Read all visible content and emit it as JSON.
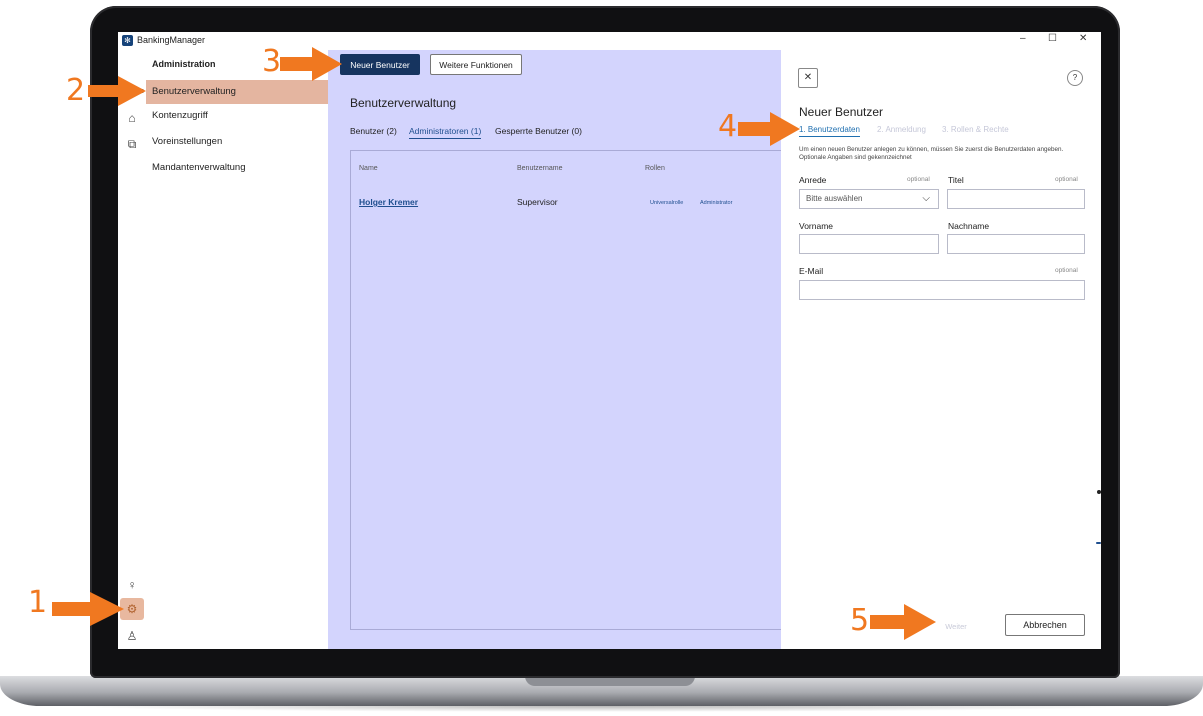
{
  "window": {
    "title": "BankingManager",
    "logo_glyph": "✻",
    "minimize": "–",
    "maximize": "☐",
    "close": "✕"
  },
  "rail": {
    "icons": [
      "bank-icon",
      "payments-icon",
      "support-icon",
      "settings-icon",
      "user-icon"
    ],
    "glyphs": {
      "bank": "⌂",
      "payments": "⧉",
      "support": "♀",
      "settings": "⚙",
      "user": "♙"
    }
  },
  "nav": {
    "header": "Administration",
    "items": [
      {
        "label": "Benutzerverwaltung",
        "active": true
      },
      {
        "label": "Kontenzugriff",
        "active": false
      },
      {
        "label": "Voreinstellungen",
        "active": false
      },
      {
        "label": "Mandantenverwaltung",
        "active": false
      }
    ]
  },
  "toolbar": {
    "new_user": "Neuer Benutzer",
    "more_functions": "Weitere Funktionen"
  },
  "main": {
    "title": "Benutzerverwaltung",
    "tabs": [
      {
        "label": "Benutzer (2)",
        "active": false
      },
      {
        "label": "Administratoren (1)",
        "active": true
      },
      {
        "label": "Gesperrte Benutzer (0)",
        "active": false
      }
    ],
    "table": {
      "headers": [
        "Name",
        "Benutzername",
        "Rollen"
      ],
      "rows": [
        {
          "name": "Holger Kremer",
          "username": "Supervisor",
          "roles": [
            "Universalrolle",
            "Administrator"
          ]
        }
      ]
    }
  },
  "drawer": {
    "close_glyph": "✕",
    "help_glyph": "?",
    "title": "Neuer Benutzer",
    "steps": [
      {
        "label": "1. Benutzerdaten",
        "active": true
      },
      {
        "label": "2. Anmeldung",
        "active": false
      },
      {
        "label": "3. Rollen & Rechte",
        "active": false
      }
    ],
    "hint": "Um einen neuen Benutzer anlegen zu können, müssen Sie zuerst die Benutzerdaten angeben. Optionale Angaben sind gekennzeichnet",
    "fields": {
      "anrede": {
        "label": "Anrede",
        "optional": "optional",
        "value": "Bitte auswählen"
      },
      "titel": {
        "label": "Titel",
        "optional": "optional",
        "value": ""
      },
      "vorname": {
        "label": "Vorname",
        "value": ""
      },
      "nachname": {
        "label": "Nachname",
        "value": ""
      },
      "email": {
        "label": "E-Mail",
        "optional": "optional",
        "value": ""
      }
    },
    "weiter": "Weiter",
    "cancel": "Abbrechen"
  },
  "markers": [
    "1",
    "2",
    "3",
    "4",
    "5"
  ],
  "colors": {
    "accent": "#16345f",
    "marker": "#f07820",
    "active_nav": "#e4b5a0",
    "main_bg": "#d3d4fd",
    "link": "#1f4f8f"
  }
}
